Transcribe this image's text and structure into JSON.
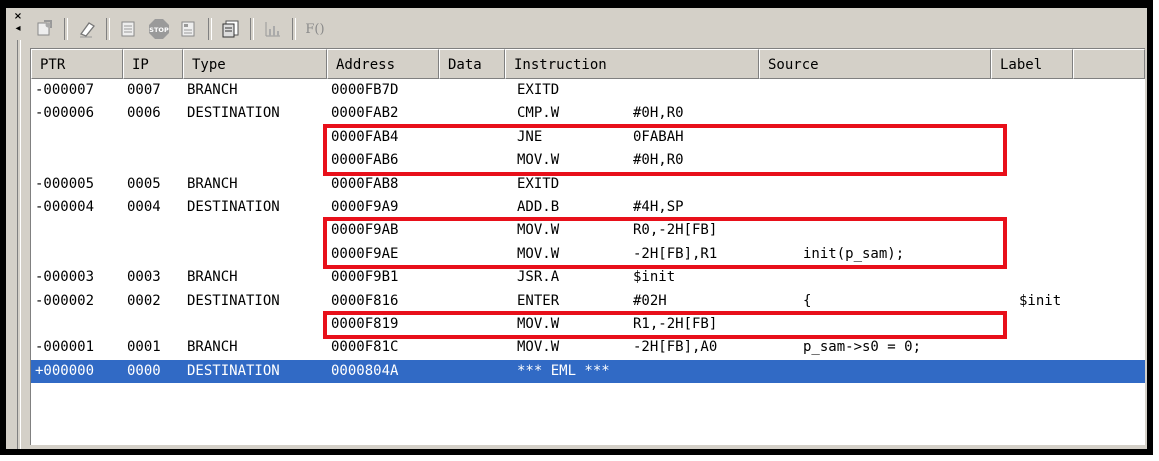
{
  "toolbar": {
    "fx_label": "F()",
    "icons": [
      "properties-icon",
      "eraser-icon",
      "trace-list-icon",
      "stop-icon",
      "trace-window-icon",
      "save-icon",
      "chart-icon",
      "function-icon"
    ]
  },
  "table": {
    "columns": [
      "PTR",
      "IP",
      "Type",
      "Address",
      "Data",
      "Instruction",
      "Source",
      "Label"
    ],
    "rows": [
      {
        "ptr": "-000007",
        "ip": "0007",
        "type": "BRANCH",
        "address": "0000FB7D",
        "data": "",
        "mnemonic": "EXITD",
        "operand": "",
        "source": "",
        "label": ""
      },
      {
        "ptr": "-000006",
        "ip": "0006",
        "type": "DESTINATION",
        "address": "0000FAB2",
        "data": "",
        "mnemonic": "CMP.W",
        "operand": "#0H,R0",
        "source": "",
        "label": ""
      },
      {
        "ptr": "",
        "ip": "",
        "type": "",
        "address": "0000FAB4",
        "data": "",
        "mnemonic": "JNE",
        "operand": "0FABAH",
        "source": "",
        "label": ""
      },
      {
        "ptr": "",
        "ip": "",
        "type": "",
        "address": "0000FAB6",
        "data": "",
        "mnemonic": "MOV.W",
        "operand": "#0H,R0",
        "source": "",
        "label": ""
      },
      {
        "ptr": "-000005",
        "ip": "0005",
        "type": "BRANCH",
        "address": "0000FAB8",
        "data": "",
        "mnemonic": "EXITD",
        "operand": "",
        "source": "",
        "label": ""
      },
      {
        "ptr": "-000004",
        "ip": "0004",
        "type": "DESTINATION",
        "address": "0000F9A9",
        "data": "",
        "mnemonic": "ADD.B",
        "operand": "#4H,SP",
        "source": "",
        "label": ""
      },
      {
        "ptr": "",
        "ip": "",
        "type": "",
        "address": "0000F9AB",
        "data": "",
        "mnemonic": "MOV.W",
        "operand": "R0,-2H[FB]",
        "source": "",
        "label": ""
      },
      {
        "ptr": "",
        "ip": "",
        "type": "",
        "address": "0000F9AE",
        "data": "",
        "mnemonic": "MOV.W",
        "operand": "-2H[FB],R1",
        "source": "init(p_sam);",
        "label": ""
      },
      {
        "ptr": "-000003",
        "ip": "0003",
        "type": "BRANCH",
        "address": "0000F9B1",
        "data": "",
        "mnemonic": "JSR.A",
        "operand": "$init",
        "source": "",
        "label": ""
      },
      {
        "ptr": "-000002",
        "ip": "0002",
        "type": "DESTINATION",
        "address": "0000F816",
        "data": "",
        "mnemonic": "ENTER",
        "operand": "#02H",
        "source": "{",
        "label": "$init"
      },
      {
        "ptr": "",
        "ip": "",
        "type": "",
        "address": "0000F819",
        "data": "",
        "mnemonic": "MOV.W",
        "operand": "R1,-2H[FB]",
        "source": "",
        "label": ""
      },
      {
        "ptr": "-000001",
        "ip": "0001",
        "type": "BRANCH",
        "address": "0000F81C",
        "data": "",
        "mnemonic": "MOV.W",
        "operand": "-2H[FB],A0",
        "source": "p_sam->s0 = 0;",
        "label": ""
      },
      {
        "ptr": "+000000",
        "ip": "0000",
        "type": "DESTINATION",
        "address": "0000804A",
        "data": "",
        "mnemonic": "*** EML ***",
        "operand": "",
        "source": "",
        "label": ""
      }
    ],
    "selected_row": 12
  },
  "highlights": [
    {
      "first_row": 2,
      "last_row": 3
    },
    {
      "first_row": 6,
      "last_row": 7
    },
    {
      "first_row": 10,
      "last_row": 10
    }
  ],
  "colors": {
    "highlight": "#e8101a",
    "selection": "#316ac5"
  }
}
